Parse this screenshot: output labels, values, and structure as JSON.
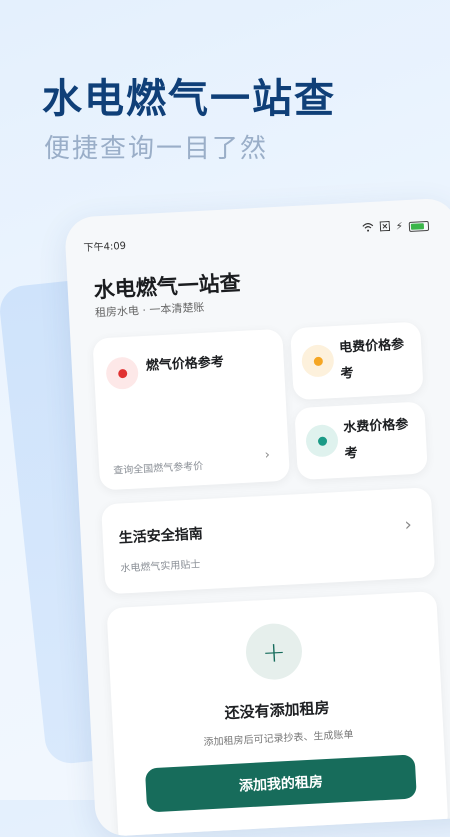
{
  "hero": {
    "title": "水电燃气一站查",
    "subtitle": "便捷查询一目了然"
  },
  "status_bar": {
    "time": "下午4:09"
  },
  "app": {
    "title": "水电燃气一站查",
    "subtitle": "租房水电 · 一本清楚账"
  },
  "cards": {
    "gas": {
      "title": "燃气价格参考",
      "desc": "查询全国燃气参考价",
      "color": "#e03131"
    },
    "electric": {
      "title_line1": "电费价格参",
      "title_line2": "考",
      "color": "#f5a623"
    },
    "water": {
      "title_line1": "水费价格参",
      "title_line2": "考",
      "color": "#1a9a86"
    }
  },
  "guide": {
    "title": "生活安全指南",
    "desc": "水电燃气实用贴士"
  },
  "empty": {
    "title": "还没有添加租房",
    "desc": "添加租房后可记录抄表、生成账单",
    "button": "添加我的租房"
  },
  "colors": {
    "hero_title": "#0f3f78",
    "accent": "#176c5b"
  }
}
